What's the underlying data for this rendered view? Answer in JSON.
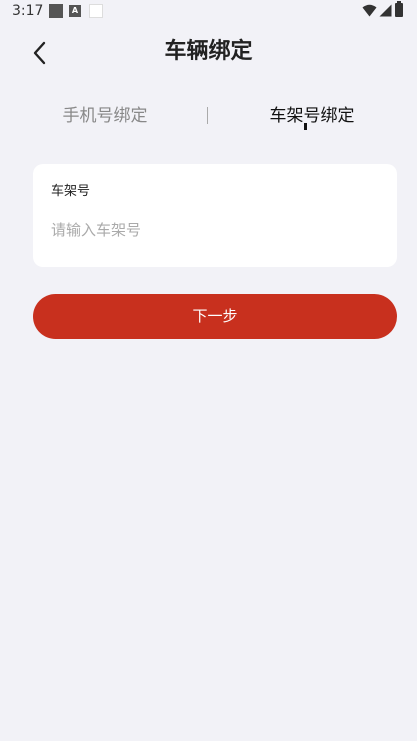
{
  "status_bar": {
    "time": "3:17",
    "icons": [
      "notification-square-icon",
      "accessibility-a-icon",
      "notification-blank-icon",
      "wifi-icon",
      "cellular-signal-icon",
      "battery-icon"
    ]
  },
  "header": {
    "title": "车辆绑定",
    "back_icon": "chevron-left-icon"
  },
  "tabs": [
    {
      "label": "手机号绑定",
      "active": false
    },
    {
      "label": "车架号绑定",
      "active": true
    }
  ],
  "form": {
    "field_label": "车架号",
    "field_value": "",
    "field_placeholder": "请输入车架号"
  },
  "actions": {
    "next_label": "下一步"
  },
  "colors": {
    "background": "#f2f2f7",
    "primary_button": "#c8301e",
    "active_tab": "#111111",
    "inactive_tab": "#888888"
  }
}
